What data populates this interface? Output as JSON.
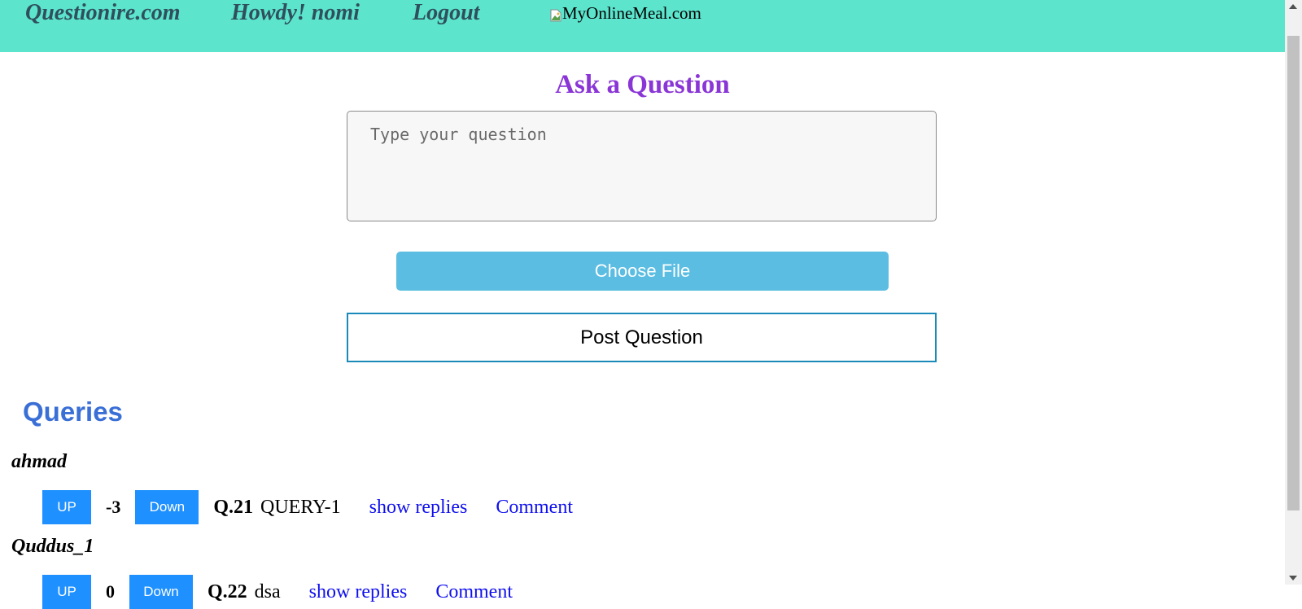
{
  "header": {
    "site_name": "Questionire.com",
    "greeting": "Howdy! nomi",
    "logout": "Logout",
    "logo_alt": "MyOnlineMeal.com"
  },
  "ask": {
    "title": "Ask a Question",
    "placeholder": "Type your question",
    "file_label": "Choose File",
    "post_label": "Post Question"
  },
  "queries": {
    "heading": "Queries",
    "items": [
      {
        "author": "ahmad",
        "up_label": "UP",
        "score": "-3",
        "down_label": "Down",
        "number": "Q.21",
        "text": "QUERY-1",
        "show_replies": "show replies",
        "comment": "Comment"
      },
      {
        "author": "Quddus_1",
        "up_label": "UP",
        "score": "0",
        "down_label": "Down",
        "number": "Q.22",
        "text": "dsa",
        "show_replies": "show replies",
        "comment": "Comment"
      }
    ]
  }
}
